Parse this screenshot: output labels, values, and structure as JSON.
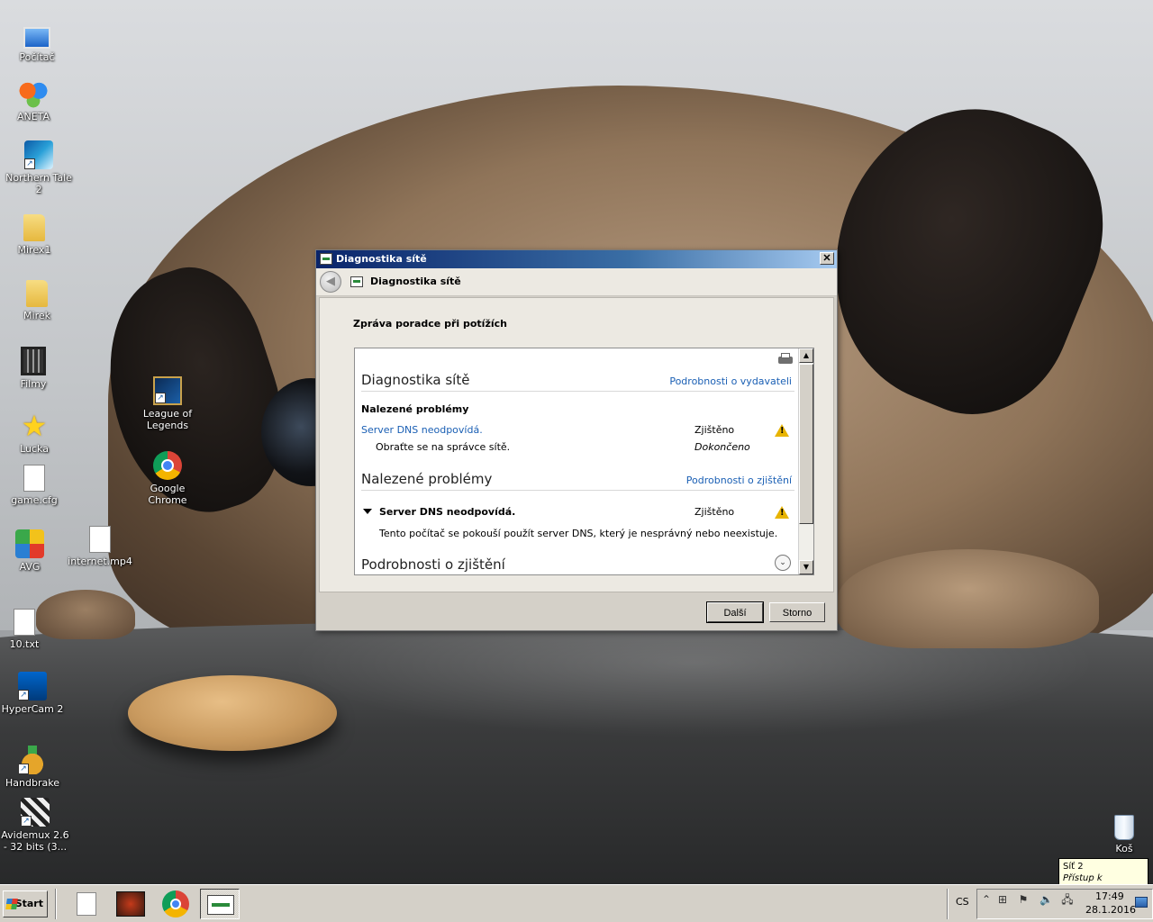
{
  "desktop_icons": [
    {
      "label": "Počítač",
      "icon": "computer-icon"
    },
    {
      "label": "ANETA",
      "icon": "butterfly-icon"
    },
    {
      "label": "Northern Tale 2",
      "icon": "game-icon"
    },
    {
      "label": "Mirex1",
      "icon": "folder-icon"
    },
    {
      "label": "Mirek",
      "icon": "folder-icon"
    },
    {
      "label": "Filmy",
      "icon": "film-icon"
    },
    {
      "label": "Lucka",
      "icon": "star-icon"
    },
    {
      "label": "game.cfg",
      "icon": "file-icon"
    },
    {
      "label": "AVG",
      "icon": "avg-icon"
    },
    {
      "label": "10.txt",
      "icon": "text-file-icon"
    },
    {
      "label": "HyperCam 2",
      "icon": "camera-icon"
    },
    {
      "label": "Handbrake",
      "icon": "pineapple-icon"
    },
    {
      "label": "Avidemux 2.6 - 32 bits (3...",
      "icon": "clapper-icon"
    },
    {
      "label": "League of Legends",
      "icon": "league-icon"
    },
    {
      "label": "Google Chrome",
      "icon": "chrome-icon"
    },
    {
      "label": "internet.mp4",
      "icon": "video-file-icon"
    },
    {
      "label": "Koš",
      "icon": "recycle-bin-icon"
    }
  ],
  "dialog": {
    "window_title": "Diagnostika sítě",
    "close_label": "✕",
    "nav_title": "Diagnostika sítě",
    "heading": "Zpráva poradce při potížích",
    "section1": {
      "title": "Diagnostika sítě",
      "link": "Podrobnosti o vydavateli",
      "subheading": "Nalezené problémy",
      "problem": "Server DNS neodpovídá.",
      "problem_status": "Zjištěno",
      "resolution": "Obraťte se na správce sítě.",
      "resolution_status": "Dokončeno"
    },
    "section2": {
      "title": "Nalezené problémy",
      "link": "Podrobnosti o zjištění",
      "problem": "Server DNS neodpovídá.",
      "problem_status": "Zjištěno",
      "description": "Tento počítač se pokouší použít server DNS, který je nesprávný nebo neexistuje."
    },
    "section3": {
      "title": "Podrobnosti o zjištění"
    },
    "buttons": {
      "next": "Další",
      "cancel": "Storno"
    }
  },
  "taskbar": {
    "start_label": "Start",
    "apps": [
      {
        "name": "Notepad",
        "active": false
      },
      {
        "name": "Game",
        "active": false
      },
      {
        "name": "Google Chrome",
        "active": false
      },
      {
        "name": "Diagnostika sítě",
        "active": true
      }
    ],
    "language": "CS",
    "time": "17:49",
    "date": "28.1.2016"
  },
  "tooltip": {
    "line1": "Síť 2",
    "line2": "Přístup k Internetu"
  },
  "colors": {
    "titlebar_start": "#0a246a",
    "link": "#1a5fb4",
    "warning": "#e8b400",
    "window_face": "#d4d0c8"
  }
}
